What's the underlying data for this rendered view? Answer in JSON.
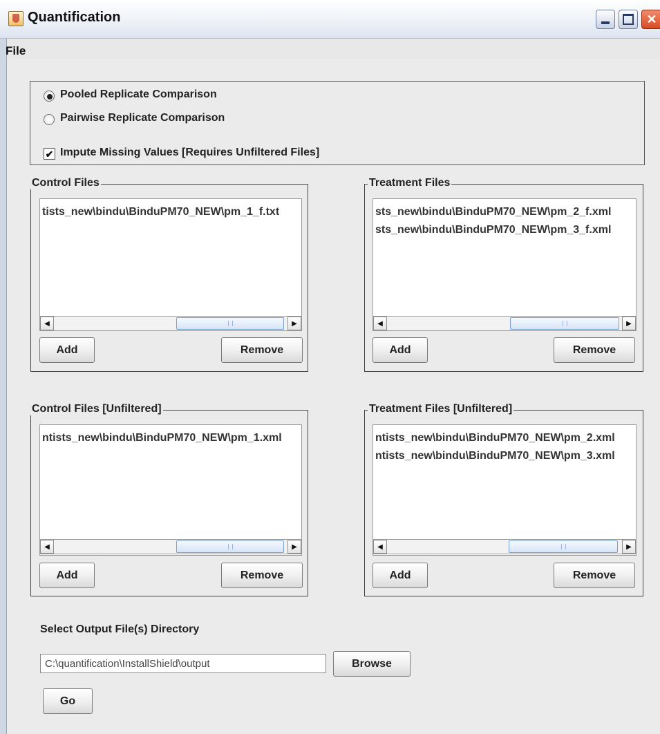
{
  "window": {
    "title": "Quantification",
    "icon": "java-cup-icon",
    "controls": [
      "minimize-icon",
      "maximize-icon",
      "close-icon"
    ]
  },
  "menu": {
    "items": [
      "File"
    ]
  },
  "options": {
    "pooled_label": "Pooled Replicate Comparison",
    "pairwise_label": "Pairwise Replicate Comparison",
    "selected": "Pooled Replicate Comparison",
    "impute_label": "Impute Missing Values [Requires Unfiltered Files]",
    "impute_checked": true,
    "check_glyph": "✔"
  },
  "panels": {
    "control": {
      "title": "Control Files",
      "files": [
        "tists_new\\bindu\\BinduPM70_NEW\\pm_1_f.txt"
      ],
      "add": "Add",
      "remove": "Remove"
    },
    "treatment": {
      "title": "Treatment Files",
      "files": [
        "sts_new\\bindu\\BinduPM70_NEW\\pm_2_f.xml",
        "sts_new\\bindu\\BinduPM70_NEW\\pm_3_f.xml"
      ],
      "add": "Add",
      "remove": "Remove"
    },
    "control_unf": {
      "title": "Control Files [Unfiltered]",
      "files": [
        "ntists_new\\bindu\\BinduPM70_NEW\\pm_1.xml"
      ],
      "add": "Add",
      "remove": "Remove"
    },
    "treatment_unf": {
      "title": "Treatment Files [Unfiltered]",
      "files": [
        "ntists_new\\bindu\\BinduPM70_NEW\\pm_2.xml",
        "ntists_new\\bindu\\BinduPM70_NEW\\pm_3.xml"
      ],
      "add": "Add",
      "remove": "Remove"
    }
  },
  "output": {
    "label": "Select Output File(s) Directory",
    "path": "C:\\quantification\\InstallShield\\output",
    "browse": "Browse",
    "go": "Go"
  }
}
